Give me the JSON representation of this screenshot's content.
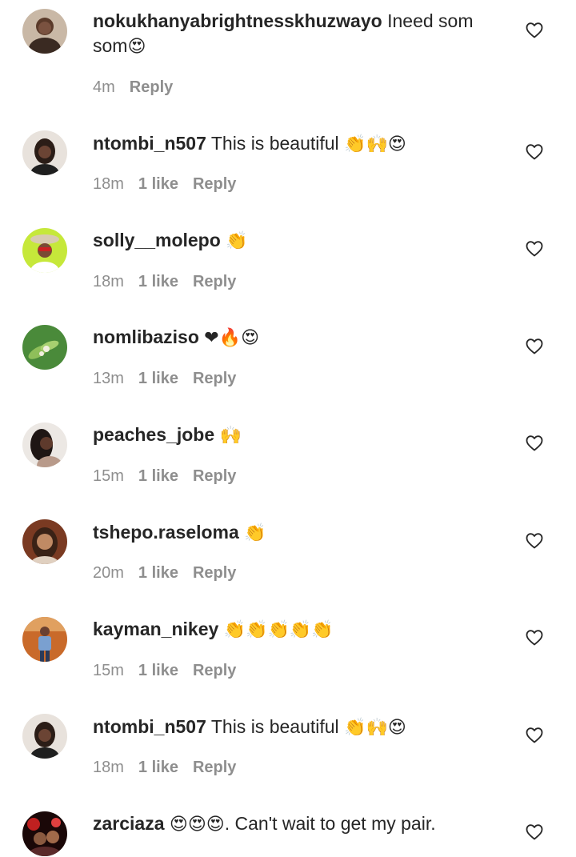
{
  "comments": [
    {
      "username": "nokukhanyabrightnesskhuzwayo",
      "text": "Ineed som som",
      "emoji": "😍",
      "time": "4m",
      "likes": "",
      "reply": "Reply"
    },
    {
      "username": "ntombi_n507",
      "text": "This is beautiful",
      "emoji": "👏🙌😍",
      "time": "18m",
      "likes": "1 like",
      "reply": "Reply"
    },
    {
      "username": "solly__molepo",
      "text": "",
      "emoji": "👏",
      "time": "18m",
      "likes": "1 like",
      "reply": "Reply"
    },
    {
      "username": "nomlibaziso",
      "text": "",
      "emoji": "❤🔥😍",
      "time": "13m",
      "likes": "1 like",
      "reply": "Reply"
    },
    {
      "username": "peaches_jobe",
      "text": "",
      "emoji": "🙌",
      "time": "15m",
      "likes": "1 like",
      "reply": "Reply"
    },
    {
      "username": "tshepo.raseloma",
      "text": "",
      "emoji": "👏",
      "time": "20m",
      "likes": "1 like",
      "reply": "Reply"
    },
    {
      "username": "kayman_nikey",
      "text": "",
      "emoji": "👏👏👏👏👏",
      "time": "15m",
      "likes": "1 like",
      "reply": "Reply"
    },
    {
      "username": "ntombi_n507",
      "text": "This is beautiful",
      "emoji": "👏🙌😍",
      "time": "18m",
      "likes": "1 like",
      "reply": "Reply"
    },
    {
      "username": "zarciaza",
      "text": ". Can't wait to get my pair.",
      "emoji": "😍😍😍",
      "time": "",
      "likes": "",
      "reply": ""
    }
  ],
  "icons": {
    "like": "heart-outline-icon"
  },
  "colors": {
    "text": "#262626",
    "meta": "#8e8e8e",
    "background": "#ffffff"
  }
}
